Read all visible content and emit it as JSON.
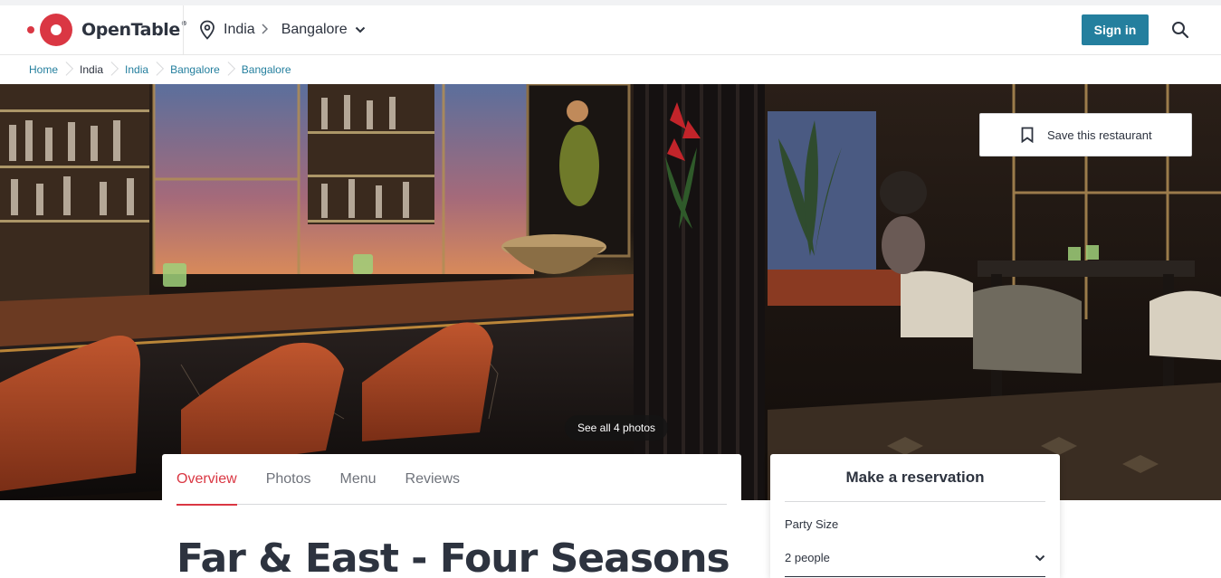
{
  "brand": {
    "name": "OpenTable",
    "reg": "®",
    "accent": "#da3743",
    "link": "#247f9e"
  },
  "header": {
    "location_country": "India",
    "location_city": "Bangalore",
    "signin_label": "Sign in",
    "icons": [
      "location-pin-icon",
      "chevron-right-icon",
      "chevron-down-icon",
      "search-icon"
    ]
  },
  "breadcrumb": [
    "Home",
    "India",
    "India",
    "Bangalore",
    "Bangalore"
  ],
  "hero": {
    "save_label": "Save this restaurant",
    "see_photos_label": "See all 4 photos"
  },
  "tabs": [
    "Overview",
    "Photos",
    "Menu",
    "Reviews"
  ],
  "restaurant": {
    "name": "Far & East - Four Seasons"
  },
  "reservation": {
    "title": "Make a reservation",
    "party_size_label": "Party Size",
    "party_size_value": "2 people"
  }
}
